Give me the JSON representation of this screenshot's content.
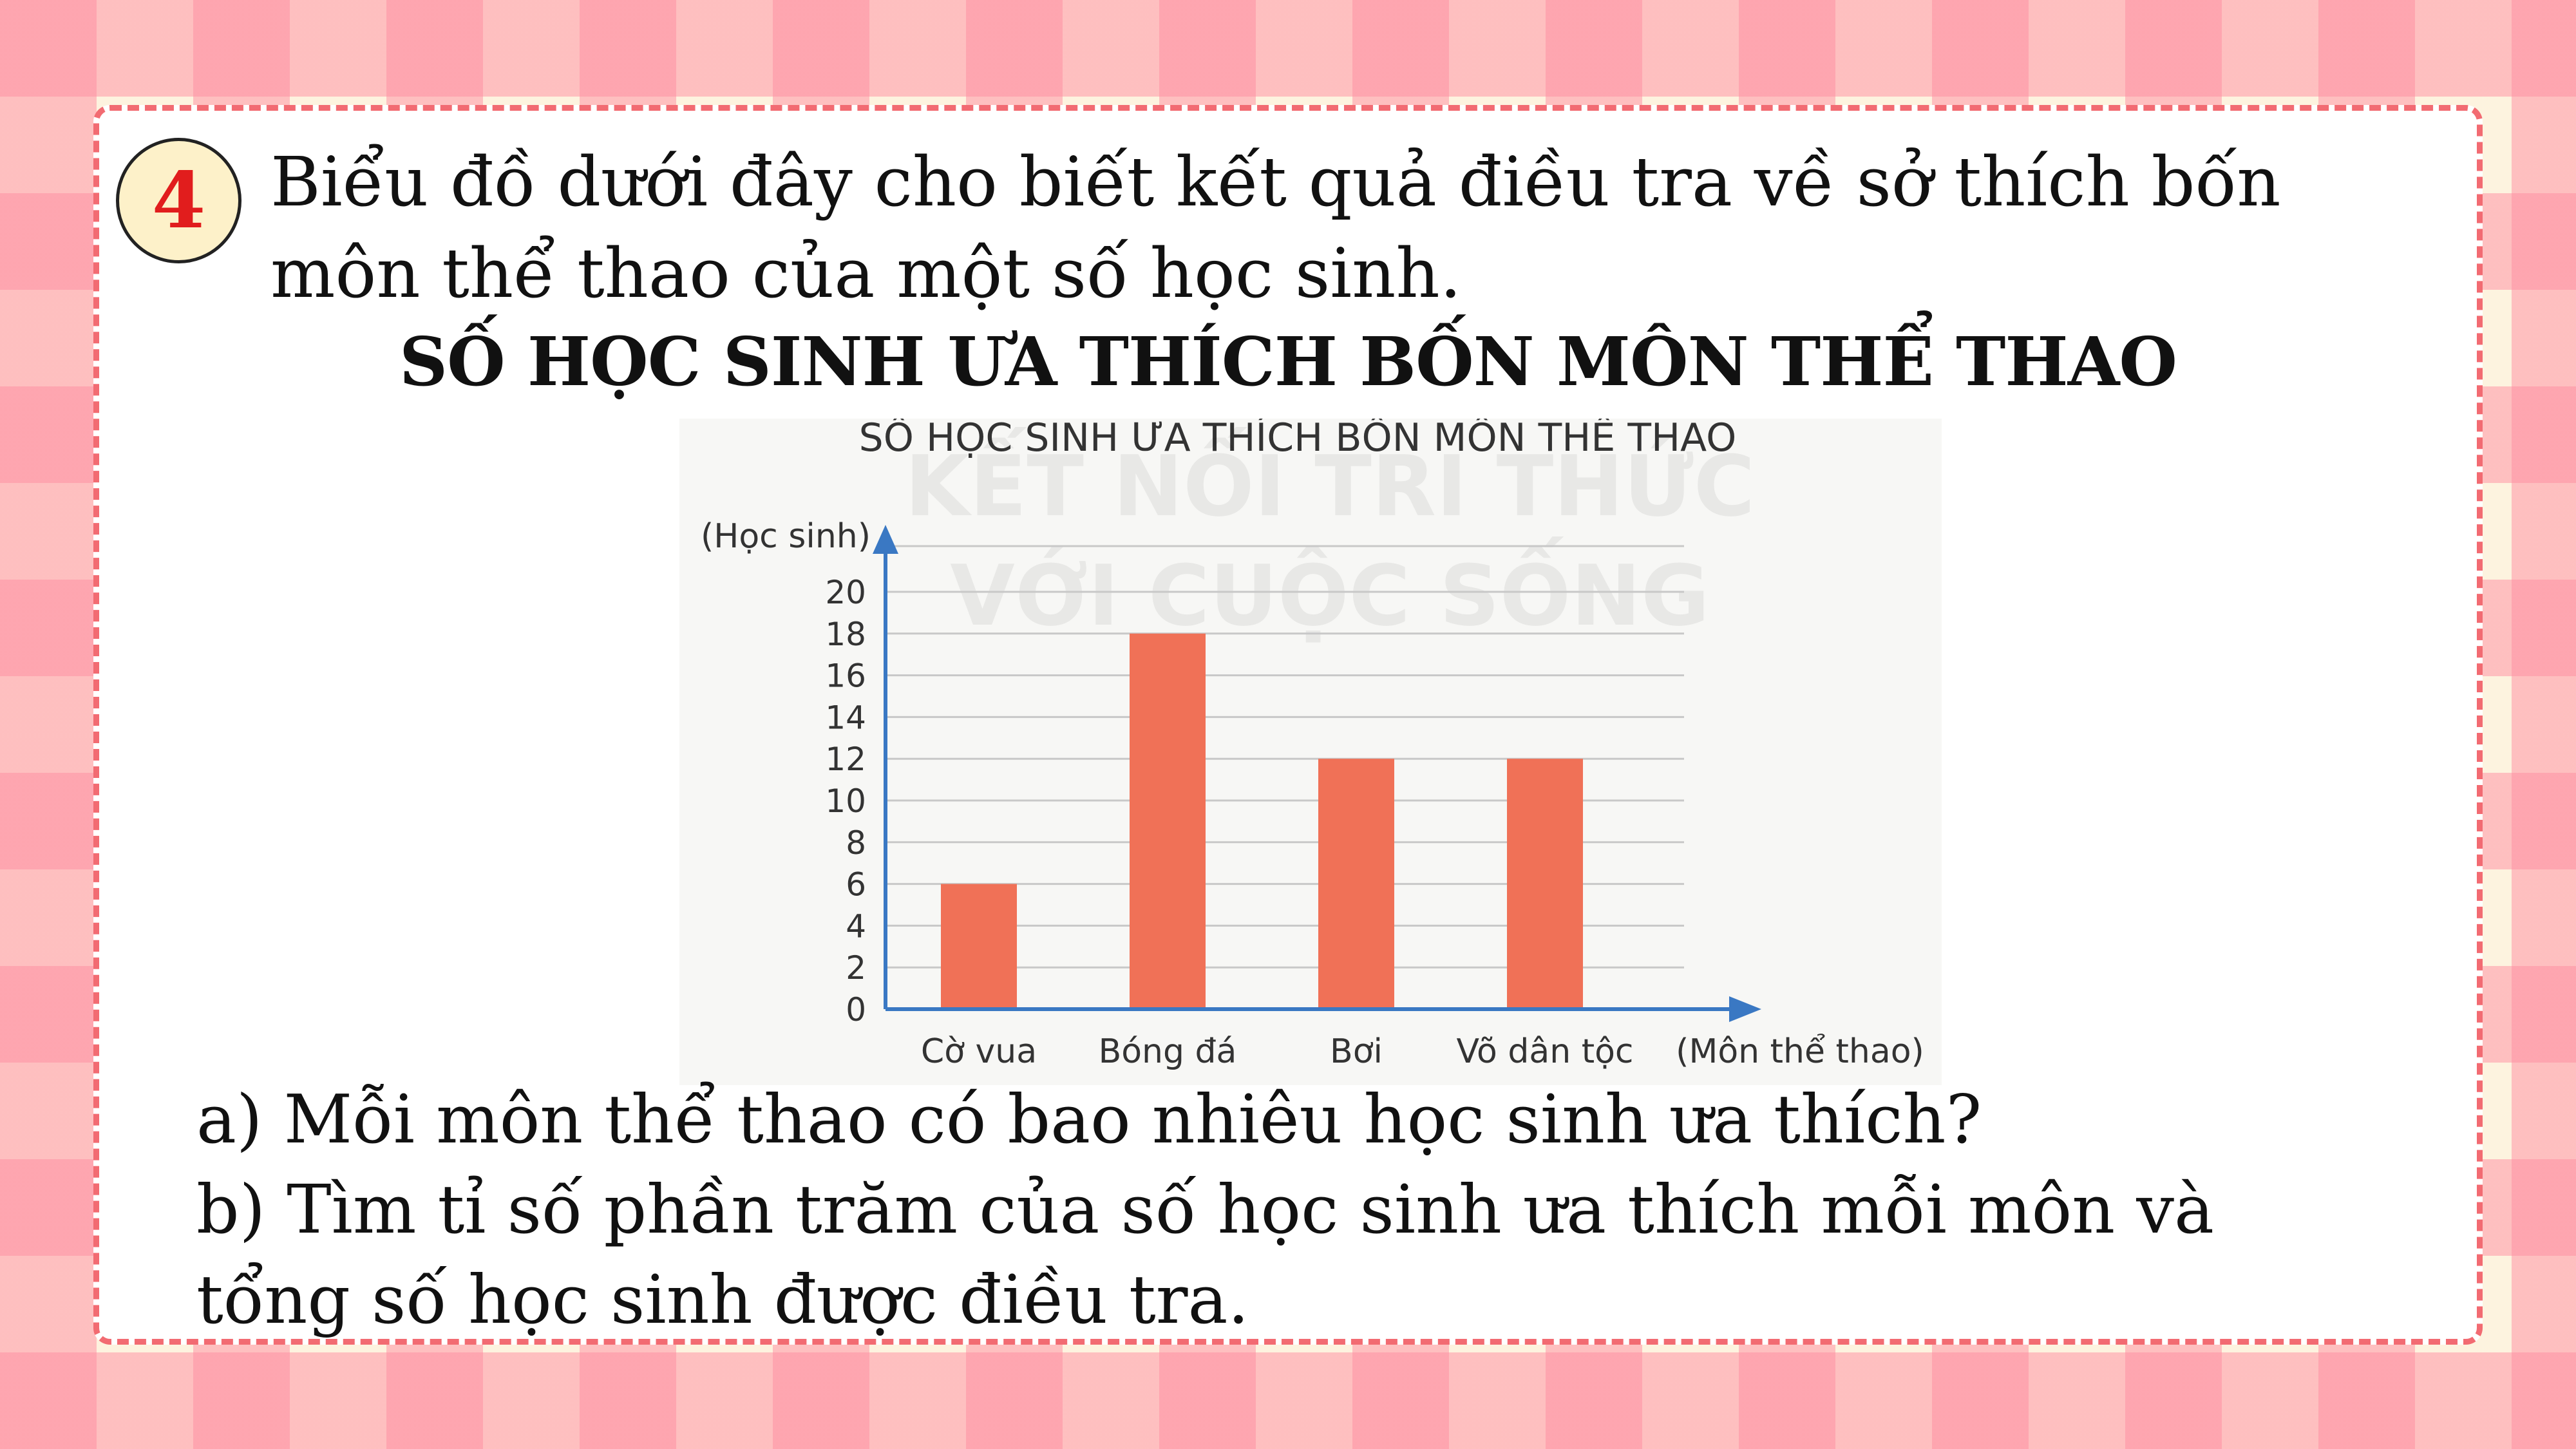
{
  "problem": {
    "number": "4",
    "intro": "Biểu đồ dưới đây cho biết kết quả điều tra về sở thích bốn môn thể thao của một số học sinh.",
    "heading": "SỐ HỌC SINH ƯA THÍCH BỐN MÔN THỂ THAO",
    "question_a": "a) Mỗi môn thể thao có bao nhiêu học sinh ưa thích?",
    "question_b": "b) Tìm tỉ số phần trăm của số học sinh ưa thích mỗi môn và tổng số học sinh được điều tra."
  },
  "watermark": {
    "line1": "KẾT NỐI TRI THỨC",
    "line2": "VỚI CUỘC SỐNG"
  },
  "colors": {
    "bar": "#f07157",
    "axis": "#3a78c3",
    "grid": "#c8c8c8",
    "circle_fill": "#fdf1c9",
    "circle_text": "#e11d1d",
    "border": "#f26b72"
  },
  "chart_data": {
    "type": "bar",
    "title": "SỐ HỌC SINH ƯA THÍCH BỐN MÔN THỂ THAO",
    "xlabel": "(Môn thể thao)",
    "ylabel": "(Học sinh)",
    "categories": [
      "Cờ vua",
      "Bóng đá",
      "Bơi",
      "Võ dân tộc"
    ],
    "values": [
      6,
      18,
      12,
      12
    ],
    "ylim": [
      0,
      20
    ],
    "yticks": [
      0,
      2,
      4,
      6,
      8,
      10,
      12,
      14,
      16,
      18,
      20
    ],
    "grid": true,
    "legend": "none"
  }
}
